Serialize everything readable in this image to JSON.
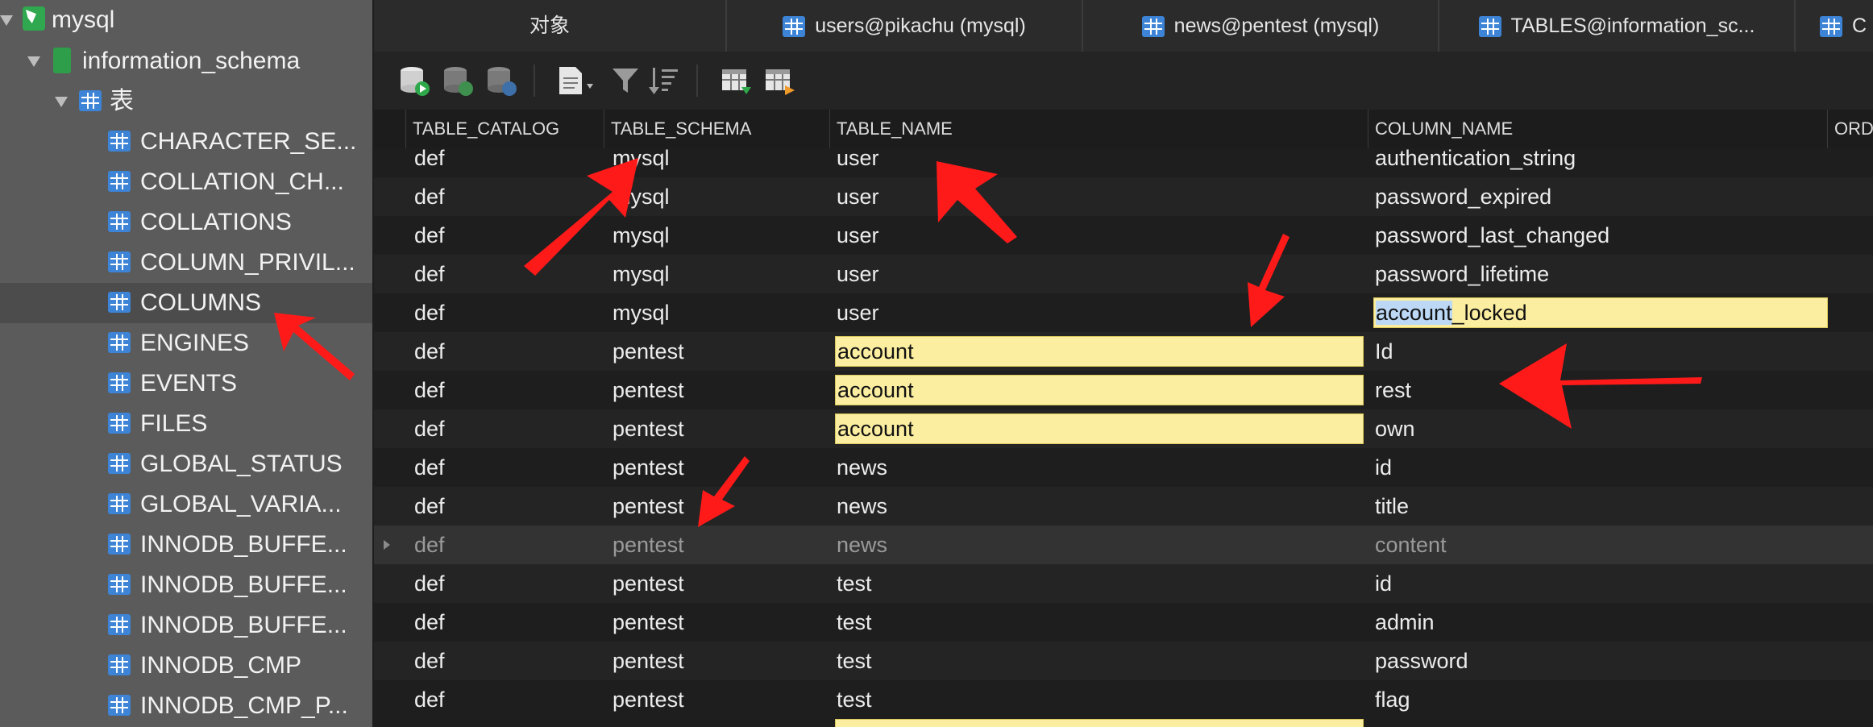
{
  "sidebar": {
    "root": "mysql",
    "schema": "information_schema",
    "tables_group": "表",
    "tables": [
      "CHARACTER_SE...",
      "COLLATION_CH...",
      "COLLATIONS",
      "COLUMN_PRIVIL...",
      "COLUMNS",
      "ENGINES",
      "EVENTS",
      "FILES",
      "GLOBAL_STATUS",
      "GLOBAL_VARIA...",
      "INNODB_BUFFE...",
      "INNODB_BUFFE...",
      "INNODB_BUFFE...",
      "INNODB_CMP",
      "INNODB_CMP_P..."
    ],
    "selected_table": "COLUMNS"
  },
  "tabs": [
    {
      "label": "对象"
    },
    {
      "label": "users@pikachu (mysql)"
    },
    {
      "label": "news@pentest (mysql)"
    },
    {
      "label": "TABLES@information_sc..."
    },
    {
      "label": "C"
    }
  ],
  "toolbar": {
    "icons": [
      "db-start-icon",
      "db-check-icon",
      "db-refresh-icon",
      "document-icon",
      "filter-icon",
      "sort-icon",
      "import-table-icon",
      "export-table-icon"
    ]
  },
  "grid": {
    "columns": [
      "TABLE_CATALOG",
      "TABLE_SCHEMA",
      "TABLE_NAME",
      "COLUMN_NAME",
      "ORD"
    ],
    "rows": [
      [
        "def",
        "mysql",
        "user",
        "authentication_string"
      ],
      [
        "def",
        "mysql",
        "user",
        "password_expired"
      ],
      [
        "def",
        "mysql",
        "user",
        "password_last_changed"
      ],
      [
        "def",
        "mysql",
        "user",
        "password_lifetime"
      ],
      [
        "def",
        "mysql",
        "user",
        "account_locked"
      ],
      [
        "def",
        "pentest",
        "account",
        "Id"
      ],
      [
        "def",
        "pentest",
        "account",
        "rest"
      ],
      [
        "def",
        "pentest",
        "account",
        "own"
      ],
      [
        "def",
        "pentest",
        "news",
        "id"
      ],
      [
        "def",
        "pentest",
        "news",
        "title"
      ],
      [
        "def",
        "pentest",
        "news",
        "content"
      ],
      [
        "def",
        "pentest",
        "test",
        "id"
      ],
      [
        "def",
        "pentest",
        "test",
        "admin"
      ],
      [
        "def",
        "pentest",
        "test",
        "password"
      ],
      [
        "def",
        "pentest",
        "test",
        "flag"
      ]
    ],
    "account_locked_split": [
      "account",
      "_locked"
    ]
  },
  "colors": {
    "highlight": "#fbeea0",
    "selection": "#bcd8f5",
    "annotation_arrow": "#ff1a1a",
    "sidebar_bg": "#5b5b5b",
    "table_icon": "#3d84d6"
  }
}
